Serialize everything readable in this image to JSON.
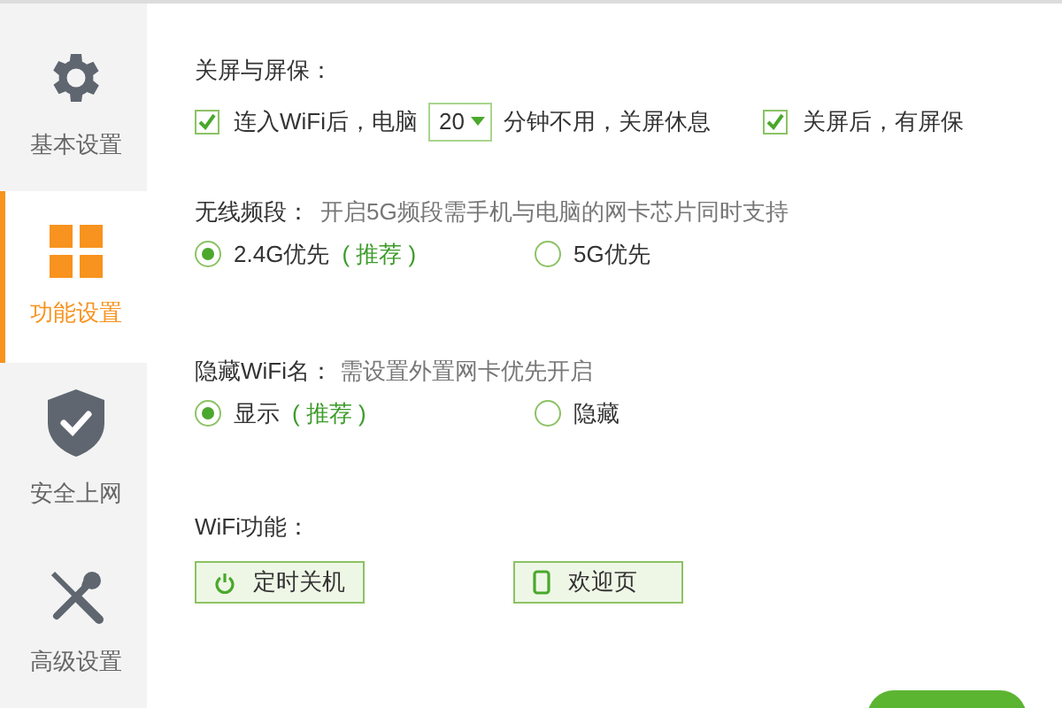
{
  "sidebar": {
    "items": [
      {
        "label": "基本设置",
        "kind": "gear",
        "selected": false
      },
      {
        "label": "功能设置",
        "kind": "grid",
        "selected": true
      },
      {
        "label": "安全上网",
        "kind": "shield",
        "selected": false
      },
      {
        "label": "高级设置",
        "kind": "tools",
        "selected": false
      }
    ]
  },
  "screen": {
    "title": "关屏与屏保：",
    "sleep": {
      "checked": true,
      "before": "连入WiFi后，电脑",
      "minutes": "20",
      "after": "分钟不用，关屏休息"
    },
    "saver": {
      "checked": true,
      "label": "关屏后，有屏保"
    }
  },
  "band": {
    "title": "无线频段：",
    "hint": "开启5G频段需手机与电脑的网卡芯片同时支持",
    "options": [
      {
        "label": "2.4G优先",
        "note": "( 推荐 )",
        "selected": true
      },
      {
        "label": "5G优先",
        "selected": false
      }
    ]
  },
  "hidden": {
    "title": "隐藏WiFi名：",
    "hint": "需设置外置网卡优先开启",
    "options": [
      {
        "label": "显示",
        "note": "( 推荐 )",
        "selected": true
      },
      {
        "label": "隐藏",
        "selected": false
      }
    ]
  },
  "functions": {
    "title": "WiFi功能：",
    "buttons": [
      {
        "label": "定时关机",
        "kind": "power"
      },
      {
        "label": "欢迎页",
        "kind": "phone"
      }
    ]
  }
}
